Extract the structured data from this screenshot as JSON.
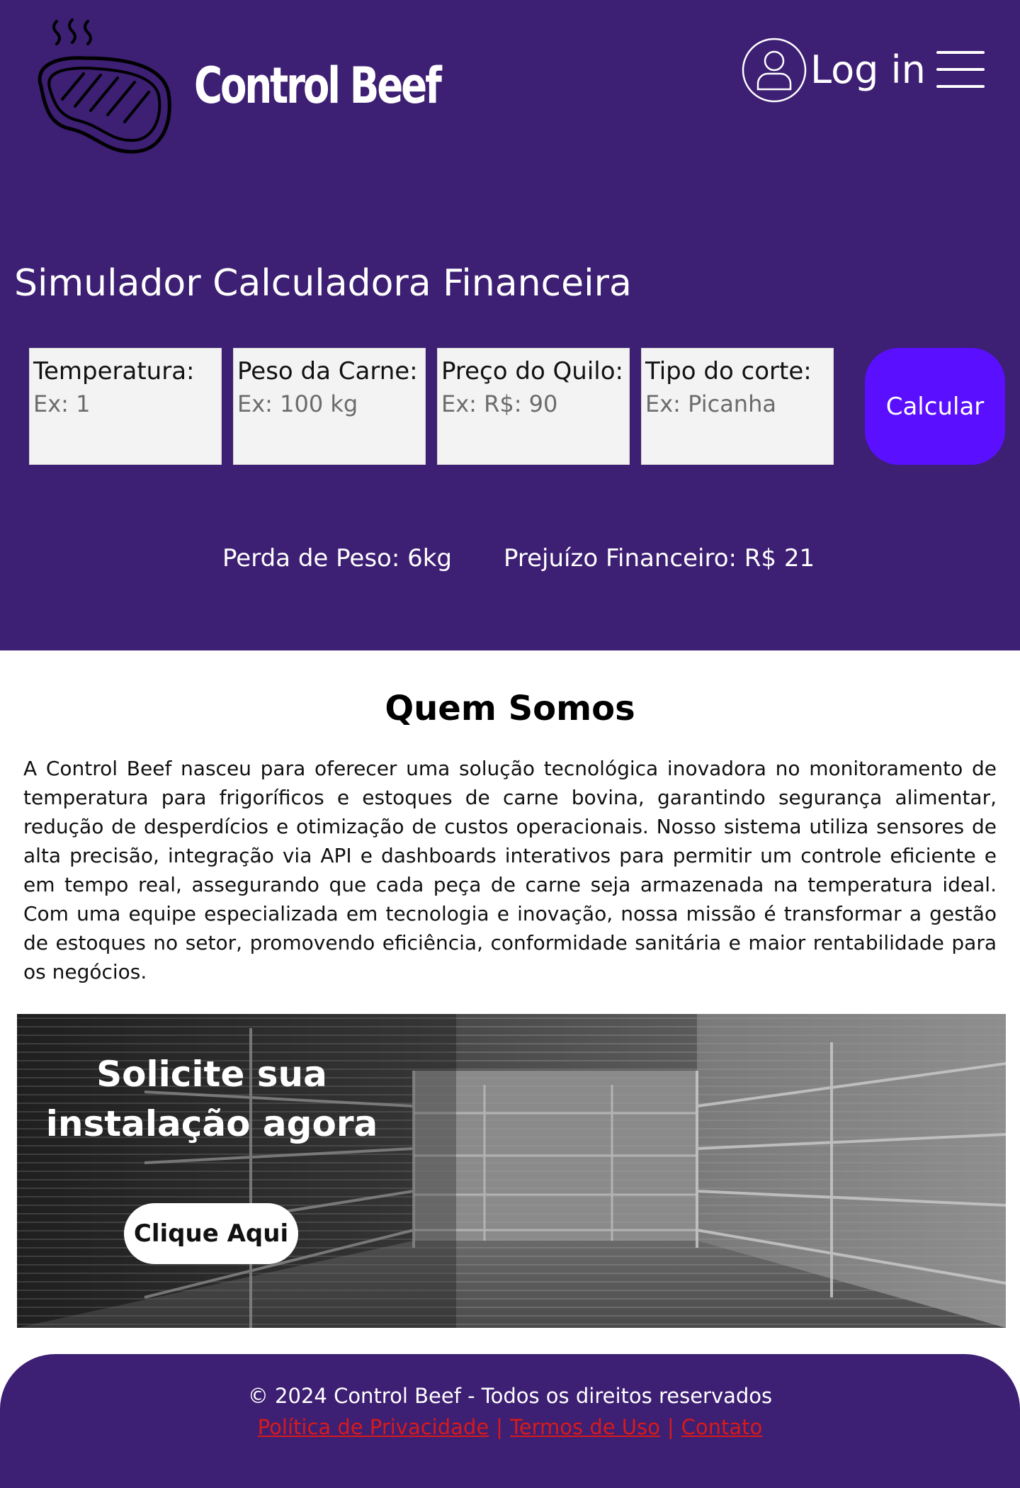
{
  "header": {
    "brand": "Control Beef",
    "login_label": "Log in"
  },
  "simulator": {
    "title": "Simulador Calculadora Financeira",
    "fields": [
      {
        "label": "Temperatura:",
        "placeholder": "Ex: 1"
      },
      {
        "label": "Peso da Carne:",
        "placeholder": "Ex: 100 kg"
      },
      {
        "label": "Preço do Quilo:",
        "placeholder": "Ex: R$: 90"
      },
      {
        "label": "Tipo do corte:",
        "placeholder": "Ex: Picanha"
      }
    ],
    "button_label": "Calcular",
    "results": {
      "weight_loss": "Perda de Peso: 6kg",
      "financial_loss": "Prejuízo Financeiro: R$ 21"
    }
  },
  "about": {
    "title": "Quem Somos",
    "text": "A Control Beef nasceu para oferecer uma solução tecnológica inovadora no monitoramento de temperatura para frigoríficos e estoques de carne bovina, garantindo segurança alimentar, redução de desperdícios e otimização de custos operacionais. Nosso sistema utiliza sensores de alta precisão, integração via API e dashboards interativos para permitir um controle eficiente e em tempo real, assegurando que cada peça de carne seja armazenada na temperatura ideal. Com uma equipe especializada em tecnologia e inovação, nossa missão é transformar a gestão de estoques no setor, promovendo eficiência, conformidade sanitária e maior rentabilidade para os negócios."
  },
  "cta": {
    "title": "Solicite sua instalação agora",
    "button_label": "Clique Aqui"
  },
  "footer": {
    "copyright": "© 2024 Control Beef - Todos os direitos reservados",
    "links": [
      "Política de Privacidade",
      "Termos de Uso",
      "Contato"
    ],
    "separator": "|"
  },
  "colors": {
    "brand_purple": "#3d1f73",
    "button_purple": "#5a10ff",
    "input_bg": "#f3f3f3",
    "link_red": "#d81a1a"
  },
  "icons": {
    "logo": "steak-icon",
    "login": "user-circle-icon",
    "menu": "hamburger-menu-icon"
  }
}
